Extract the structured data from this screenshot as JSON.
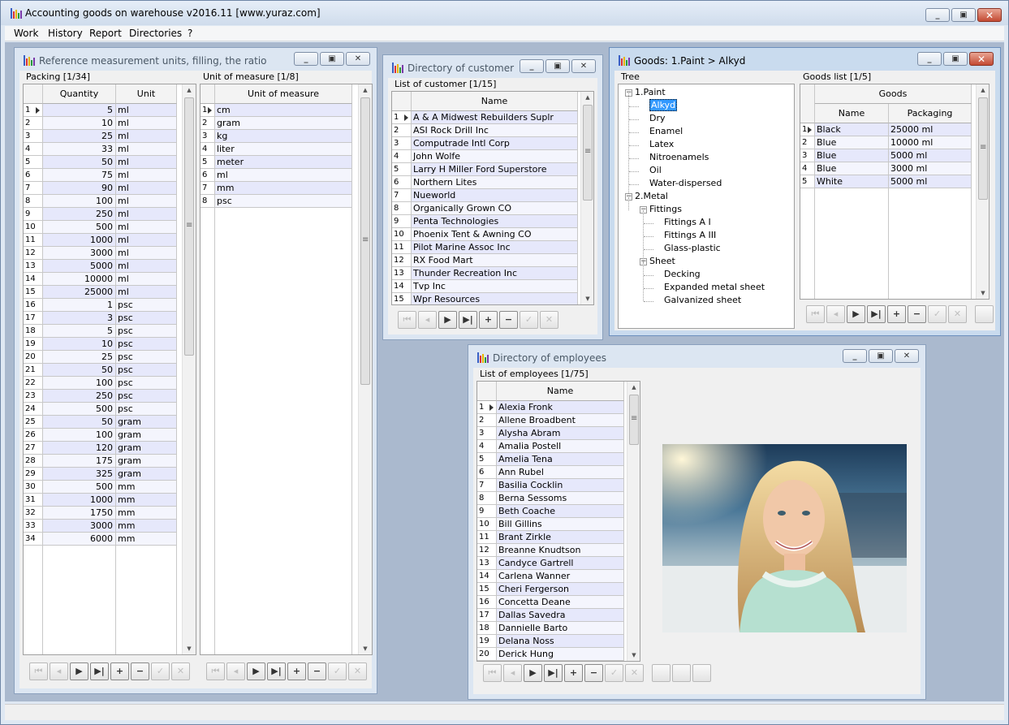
{
  "app": {
    "title": "Accounting goods on warehouse v2016.11 [www.yuraz.com]",
    "menu": [
      "Work",
      "History",
      "Report",
      "Directories",
      "?"
    ]
  },
  "windows": {
    "reference": {
      "title": "Reference measurement units, filling, the ratio",
      "packing_label": "Packing [1/34]",
      "packing_columns": [
        "Quantity",
        "Unit"
      ],
      "packing_rows": [
        [
          "1",
          "5",
          "ml"
        ],
        [
          "2",
          "10",
          "ml"
        ],
        [
          "3",
          "25",
          "ml"
        ],
        [
          "4",
          "33",
          "ml"
        ],
        [
          "5",
          "50",
          "ml"
        ],
        [
          "6",
          "75",
          "ml"
        ],
        [
          "7",
          "90",
          "ml"
        ],
        [
          "8",
          "100",
          "ml"
        ],
        [
          "9",
          "250",
          "ml"
        ],
        [
          "10",
          "500",
          "ml"
        ],
        [
          "11",
          "1000",
          "ml"
        ],
        [
          "12",
          "3000",
          "ml"
        ],
        [
          "13",
          "5000",
          "ml"
        ],
        [
          "14",
          "10000",
          "ml"
        ],
        [
          "15",
          "25000",
          "ml"
        ],
        [
          "16",
          "1",
          "psc"
        ],
        [
          "17",
          "3",
          "psc"
        ],
        [
          "18",
          "5",
          "psc"
        ],
        [
          "19",
          "10",
          "psc"
        ],
        [
          "20",
          "25",
          "psc"
        ],
        [
          "21",
          "50",
          "psc"
        ],
        [
          "22",
          "100",
          "psc"
        ],
        [
          "23",
          "250",
          "psc"
        ],
        [
          "24",
          "500",
          "psc"
        ],
        [
          "25",
          "50",
          "gram"
        ],
        [
          "26",
          "100",
          "gram"
        ],
        [
          "27",
          "120",
          "gram"
        ],
        [
          "28",
          "175",
          "gram"
        ],
        [
          "29",
          "325",
          "gram"
        ],
        [
          "30",
          "500",
          "mm"
        ],
        [
          "31",
          "1000",
          "mm"
        ],
        [
          "32",
          "1750",
          "mm"
        ],
        [
          "33",
          "3000",
          "mm"
        ],
        [
          "34",
          "6000",
          "mm"
        ]
      ],
      "unit_label": "Unit of measure [1/8]",
      "unit_column": "Unit of measure",
      "unit_rows": [
        [
          "1",
          "cm"
        ],
        [
          "2",
          "gram"
        ],
        [
          "3",
          "kg"
        ],
        [
          "4",
          "liter"
        ],
        [
          "5",
          "meter"
        ],
        [
          "6",
          "ml"
        ],
        [
          "7",
          "mm"
        ],
        [
          "8",
          "psc"
        ]
      ]
    },
    "customer": {
      "title": "Directory of customer",
      "list_label": "List of customer [1/15]",
      "column": "Name",
      "rows": [
        [
          "1",
          "A & A Midwest Rebuilders Suplr"
        ],
        [
          "2",
          "ASI Rock Drill Inc"
        ],
        [
          "3",
          "Computrade Intl Corp"
        ],
        [
          "4",
          "John Wolfe"
        ],
        [
          "5",
          "Larry H Miller Ford Superstore"
        ],
        [
          "6",
          "Northern Lites"
        ],
        [
          "7",
          "Nueworld"
        ],
        [
          "8",
          "Organically Grown CO"
        ],
        [
          "9",
          "Penta Technologies"
        ],
        [
          "10",
          "Phoenix Tent & Awning CO"
        ],
        [
          "11",
          "Pilot Marine Assoc Inc"
        ],
        [
          "12",
          "RX Food Mart"
        ],
        [
          "13",
          "Thunder Recreation Inc"
        ],
        [
          "14",
          "Tvp Inc"
        ],
        [
          "15",
          "Wpr Resources"
        ]
      ]
    },
    "goods": {
      "title": "Goods: 1.Paint > Alkyd",
      "tree_label": "Tree",
      "tree": [
        {
          "label": "1.Paint",
          "level": 0,
          "expander": "−"
        },
        {
          "label": "Alkyd",
          "level": 1,
          "selected": true
        },
        {
          "label": "Dry",
          "level": 1
        },
        {
          "label": "Enamel",
          "level": 1
        },
        {
          "label": "Latex",
          "level": 1
        },
        {
          "label": "Nitroenamels",
          "level": 1
        },
        {
          "label": "Oil",
          "level": 1
        },
        {
          "label": "Water-dispersed",
          "level": 1
        },
        {
          "label": "2.Metal",
          "level": 0,
          "expander": "−"
        },
        {
          "label": "Fittings",
          "level": 1,
          "expander": "−"
        },
        {
          "label": "Fittings A I",
          "level": 2
        },
        {
          "label": "Fittings A III",
          "level": 2
        },
        {
          "label": "Glass-plastic",
          "level": 2
        },
        {
          "label": "Sheet",
          "level": 1,
          "expander": "−"
        },
        {
          "label": "Decking",
          "level": 2
        },
        {
          "label": "Expanded metal sheet",
          "level": 2
        },
        {
          "label": "Galvanized sheet",
          "level": 2
        }
      ],
      "list_label": "Goods list [1/5]",
      "group_header": "Goods",
      "columns": [
        "Name",
        "Packaging"
      ],
      "rows": [
        [
          "1",
          "Black",
          "25000 ml"
        ],
        [
          "2",
          "Blue",
          "10000 ml"
        ],
        [
          "3",
          "Blue",
          "5000 ml"
        ],
        [
          "4",
          "Blue",
          "3000 ml"
        ],
        [
          "5",
          "White",
          "5000 ml"
        ]
      ]
    },
    "employees": {
      "title": "Directory of employees",
      "list_label": "List of employees [1/75]",
      "column": "Name",
      "rows": [
        [
          "1",
          "Alexia Fronk"
        ],
        [
          "2",
          "Allene Broadbent"
        ],
        [
          "3",
          "Alysha Abram"
        ],
        [
          "4",
          "Amalia Postell"
        ],
        [
          "5",
          "Amelia Tena"
        ],
        [
          "6",
          "Ann Rubel"
        ],
        [
          "7",
          "Basilia Cocklin"
        ],
        [
          "8",
          "Berna Sessoms"
        ],
        [
          "9",
          "Beth Coache"
        ],
        [
          "10",
          "Bill Gillins"
        ],
        [
          "11",
          "Brant Zirkle"
        ],
        [
          "12",
          "Breanne Knudtson"
        ],
        [
          "13",
          "Candyce Gartrell"
        ],
        [
          "14",
          "Carlena Wanner"
        ],
        [
          "15",
          "Cheri Fergerson"
        ],
        [
          "16",
          "Concetta Deane"
        ],
        [
          "17",
          "Dallas Savedra"
        ],
        [
          "18",
          "Dannielle Barto"
        ],
        [
          "19",
          "Delana Noss"
        ],
        [
          "20",
          "Derick Hung"
        ]
      ]
    }
  },
  "navigator_icons": [
    "first-icon",
    "prior-icon",
    "next-icon",
    "last-icon",
    "insert-icon",
    "delete-icon",
    "post-icon",
    "cancel-icon"
  ],
  "colors": {
    "row_selected": "#e6e8fb",
    "tree_selection": "#3399ff",
    "desktop": "#aab9ce",
    "close_button": "#c34a33"
  }
}
